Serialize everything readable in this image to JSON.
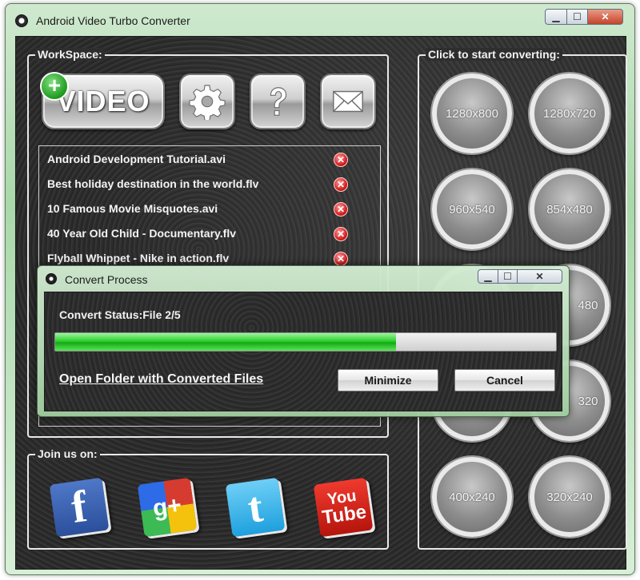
{
  "window": {
    "title": "Android Video Turbo Converter",
    "minimize_glyph": "▁",
    "maximize_glyph": "☐",
    "close_glyph": "✕"
  },
  "workspace": {
    "label": "WorkSpace:",
    "video_button_label": "VIDEO",
    "plus_glyph": "+",
    "toolbar_icons": [
      "gear-icon",
      "help-icon",
      "mail-icon"
    ],
    "files": [
      "Android Development Tutorial.avi",
      "Best holiday destination in the world.flv",
      "10 Famous Movie Misquotes.avi",
      "40 Year Old Child - Documentary.flv",
      "Flyball Whippet - Nike in action.flv"
    ],
    "remove_glyph": "✕"
  },
  "convert": {
    "label": "Click to start converting:",
    "resolutions": [
      "1280x800",
      "1280x720",
      "960x540",
      "854x480",
      "480",
      "",
      "",
      "320",
      "400x240",
      "320x240"
    ]
  },
  "join": {
    "label": "Join us on:",
    "facebook_glyph": "f",
    "googleplus_glyph": "g+",
    "twitter_glyph": "t",
    "youtube_you": "You",
    "youtube_tube": "Tube"
  },
  "dialog": {
    "title": "Convert Process",
    "status": "Convert Status:File 2/5",
    "progress_fraction": 0.68,
    "open_folder_link": "Open Folder with Converted Files",
    "minimize_button": "Minimize",
    "cancel_button": "Cancel",
    "minimize_glyph": "▁",
    "maximize_glyph": "☐",
    "close_glyph": "✕"
  },
  "colors": {
    "progress_green": "#2fcf2f",
    "remove_red": "#d11a1a",
    "frame_green": "#a9d8a9"
  }
}
